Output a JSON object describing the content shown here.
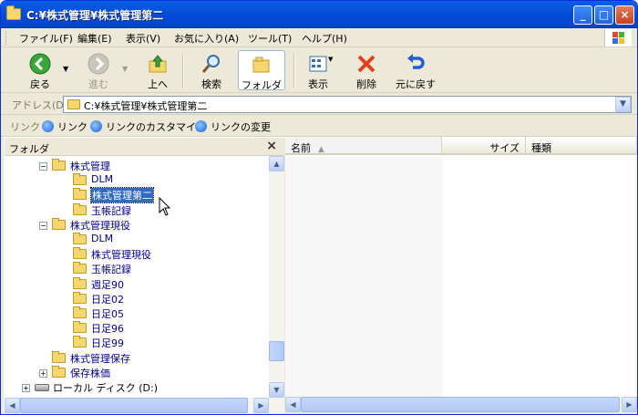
{
  "window": {
    "title": "C:¥株式管理¥株式管理第二"
  },
  "menu": [
    "ファイル(F)",
    "編集(E)",
    "表示(V)",
    "お気に入り(A)",
    "ツール(T)",
    "ヘルプ(H)"
  ],
  "toolbar": {
    "back": "戻る",
    "forward": "進む",
    "up": "上へ",
    "search": "検索",
    "folders": "フォルダ",
    "view": "表示",
    "delete": "削除",
    "undo": "元に戻す"
  },
  "address": {
    "label": "アドレス(D)",
    "value": "C:¥株式管理¥株式管理第二"
  },
  "links": {
    "label": "リンク",
    "items": [
      "リンク",
      "リンクのカスタマイズ",
      "リンクの変更"
    ]
  },
  "folder_pane": {
    "title": "フォルダ",
    "close": "×",
    "nodes": [
      {
        "label": "株式管理",
        "level": 2,
        "toggle": "⊟"
      },
      {
        "label": "DLM",
        "level": 3
      },
      {
        "label": "株式管理第二",
        "level": 3,
        "selected": true
      },
      {
        "label": "玉帳記録",
        "level": 3
      },
      {
        "label": "株式管理現役",
        "level": 2,
        "toggle": "⊟"
      },
      {
        "label": "DLM",
        "level": 3
      },
      {
        "label": "株式管理現役",
        "level": 3
      },
      {
        "label": "玉帳記録",
        "level": 3
      },
      {
        "label": "週足90",
        "level": 3
      },
      {
        "label": "日足02",
        "level": 3
      },
      {
        "label": "日足05",
        "level": 3
      },
      {
        "label": "日足96",
        "level": 3
      },
      {
        "label": "日足99",
        "level": 3
      },
      {
        "label": "株式管理保存",
        "level": 2
      },
      {
        "label": "保存株価",
        "level": 2,
        "toggle": "⊞"
      },
      {
        "label": "ローカル ディスク (D:)",
        "level": 1,
        "toggle": "⊞",
        "drive": true
      }
    ]
  },
  "file_pane": {
    "columns": [
      "名前",
      "サイズ",
      "種類"
    ]
  },
  "colors": {
    "title_bar": "#0349d6",
    "selection": "#316ac5",
    "folder": "#f5d770"
  }
}
